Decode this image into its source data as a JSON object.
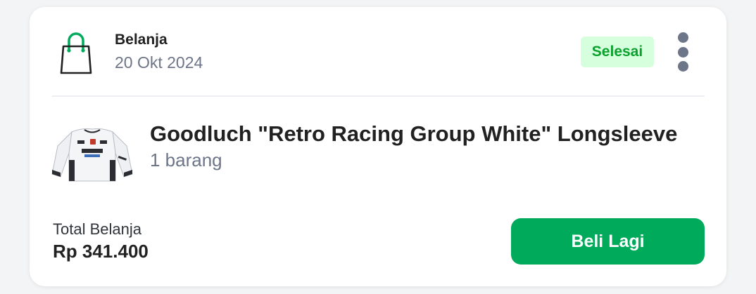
{
  "order": {
    "category": "Belanja",
    "date": "20 Okt 2024",
    "status": "Selesai",
    "more_icon": "more-vertical-icon",
    "bag_icon": "shopping-bag-icon"
  },
  "product": {
    "title": "Goodluch \"Retro Racing Group White\" Longsleeve",
    "item_count": "1 barang"
  },
  "total": {
    "label": "Total Belanja",
    "value": "Rp 341.400"
  },
  "actions": {
    "buy_again_label": "Beli Lagi"
  },
  "colors": {
    "accent": "#00aa5b",
    "status_bg": "#d6ffde",
    "status_text": "#0aa22c"
  }
}
